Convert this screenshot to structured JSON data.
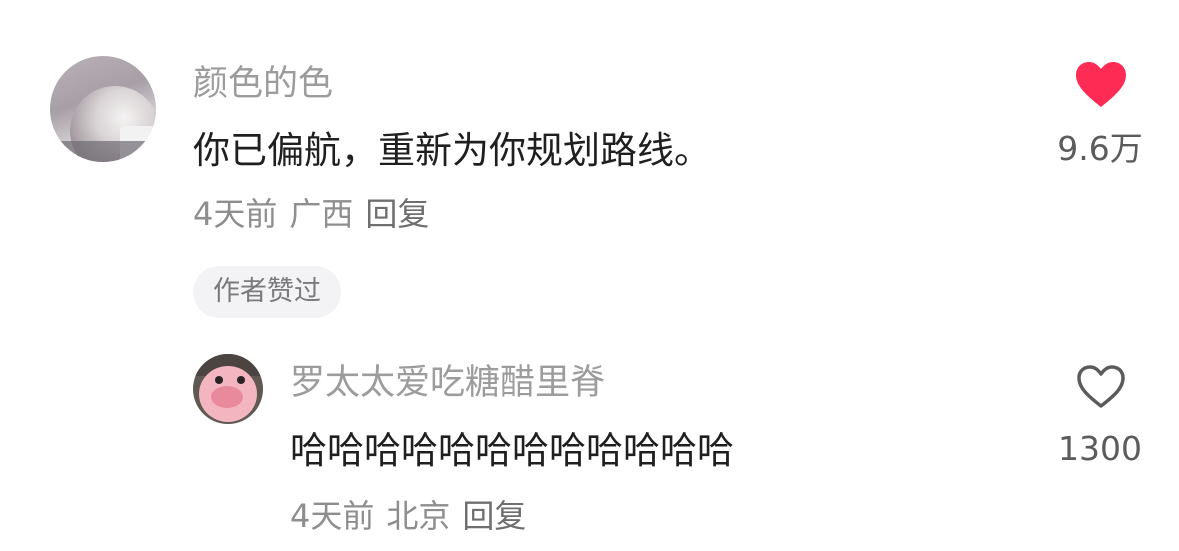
{
  "colors": {
    "like_active": "#fe2c55",
    "like_inactive": "#5b5b5b",
    "name": "#9c9c9c",
    "content": "#1f1f1f",
    "meta": "#8e8e8e"
  },
  "comments": [
    {
      "username": "颜色的色",
      "content": "你已偏航，重新为你规划路线。",
      "time": "4天前",
      "location": "广西",
      "reply_label": "回复",
      "badge": "作者赞过",
      "likes": "9.6万",
      "liked": true,
      "like_icon": "heart-filled-icon"
    },
    {
      "username": "罗太太爱吃糖醋里脊",
      "content": "哈哈哈哈哈哈哈哈哈哈哈哈",
      "time": "4天前",
      "location": "北京",
      "reply_label": "回复",
      "likes": "1300",
      "liked": false,
      "like_icon": "heart-outline-icon"
    }
  ]
}
